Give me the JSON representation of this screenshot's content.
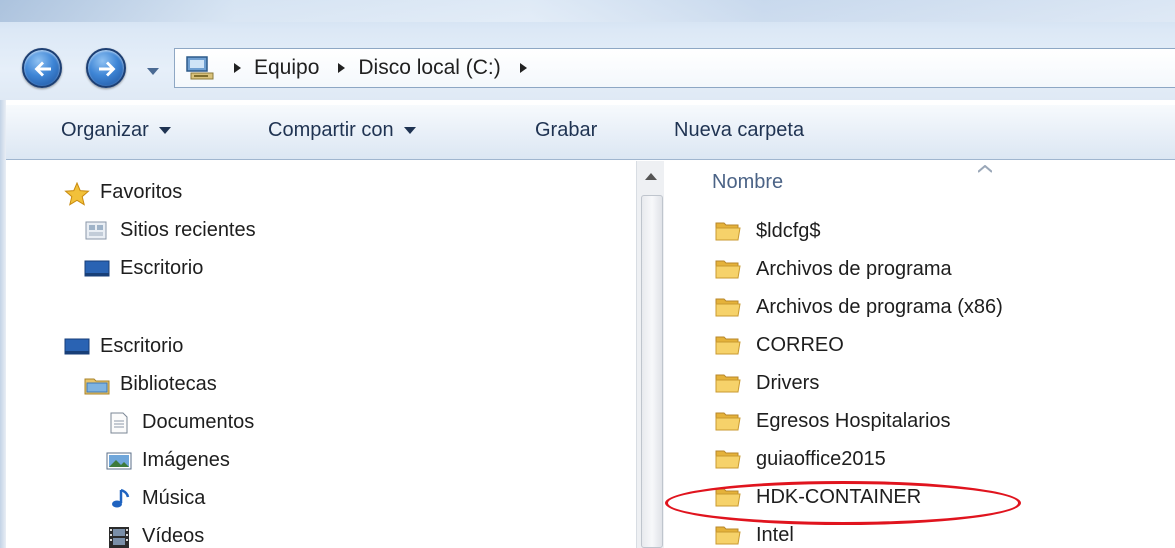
{
  "address": {
    "breadcrumbs": [
      "Equipo",
      "Disco local (C:)"
    ]
  },
  "toolbar": {
    "organize_label": "Organizar",
    "share_label": "Compartir con",
    "burn_label": "Grabar",
    "new_folder_label": "Nueva carpeta"
  },
  "navigation": {
    "favorites_label": "Favoritos",
    "recent_label": "Sitios recientes",
    "desktop_fav_label": "Escritorio",
    "desktop_label": "Escritorio",
    "libraries_label": "Bibliotecas",
    "documents_label": "Documentos",
    "images_label": "Imágenes",
    "music_label": "Música",
    "videos_label": "Vídeos"
  },
  "file_list": {
    "column_name": "Nombre",
    "items": [
      "$ldcfg$",
      "Archivos de programa",
      "Archivos de programa (x86)",
      "CORREO",
      "Drivers",
      "Egresos Hospitalarios",
      "guiaoffice2015",
      "HDK-CONTAINER",
      "Intel"
    ],
    "highlighted_item": "HDK-CONTAINER"
  },
  "colors": {
    "highlight_oval": "#e0141e",
    "folder": "#f0c24a",
    "nav_button": "#3f86d6"
  },
  "icons": {
    "back": "arrow-left-icon",
    "forward": "arrow-right-icon",
    "folder": "folder-icon"
  }
}
